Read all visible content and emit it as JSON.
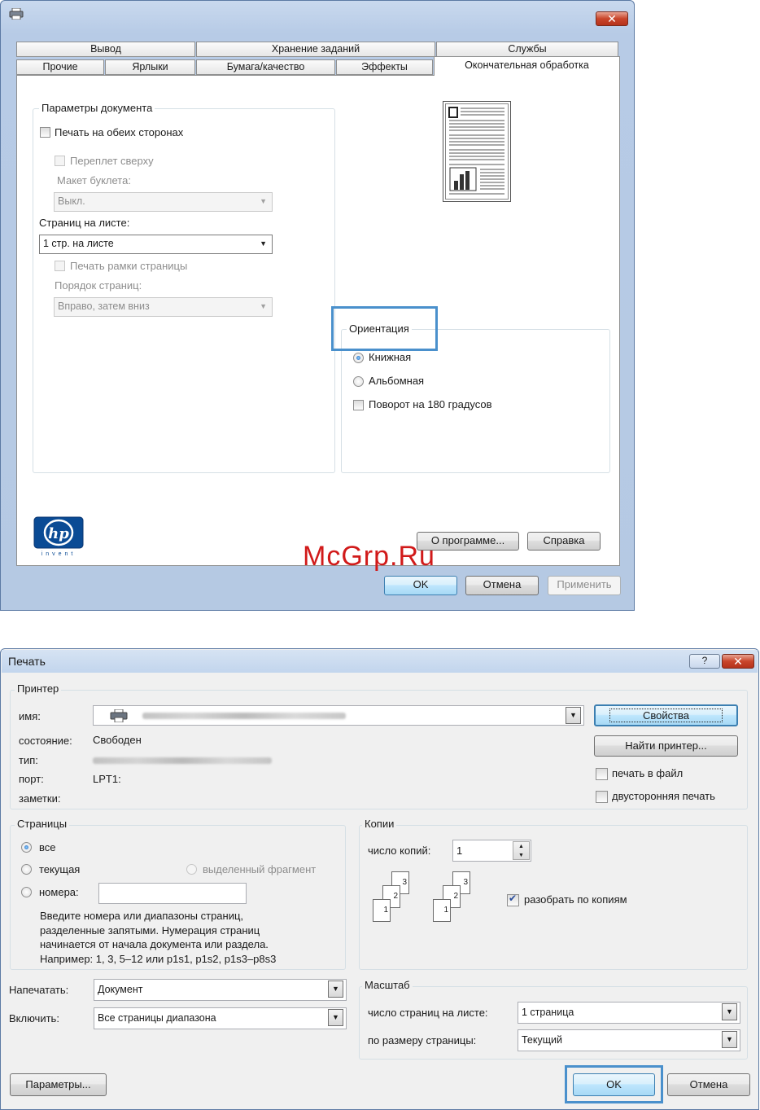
{
  "window1": {
    "tabs_row1": [
      "Вывод",
      "Хранение заданий",
      "Службы"
    ],
    "tabs_row2": [
      "Прочие",
      "Ярлыки",
      "Бумага/качество",
      "Эффекты",
      "Окончательная обработка"
    ],
    "close_glyph": "✕",
    "doc_options": {
      "title": "Параметры документа",
      "duplex": "Печать на обеих сторонах",
      "flip_up": "Переплет сверху",
      "booklet_label": "Макет буклета:",
      "booklet_value": "Выкл.",
      "pages_per_sheet_label": "Страниц на листе:",
      "pages_per_sheet_value": "1 стр. на листе",
      "page_borders": "Печать рамки страницы",
      "page_order_label": "Порядок страниц:",
      "page_order_value": "Вправо, затем вниз"
    },
    "orientation": {
      "title": "Ориентация",
      "portrait": "Книжная",
      "landscape": "Альбомная",
      "rotate": "Поворот на 180 градусов"
    },
    "logo_text": "invent",
    "buttons": {
      "about": "О программе...",
      "help": "Справка",
      "ok": "OK",
      "cancel": "Отмена",
      "apply": "Применить"
    }
  },
  "watermark": "McGrp.Ru",
  "window2": {
    "title": "Печать",
    "help_glyph": "?",
    "close_glyph": "✕",
    "printer": {
      "group": "Принтер",
      "name_label": "имя:",
      "status_label": "состояние:",
      "status_value": "Свободен",
      "type_label": "тип:",
      "port_label": "порт:",
      "port_value": "LPT1:",
      "notes_label": "заметки:",
      "properties": "Свойства",
      "find_printer": "Найти принтер...",
      "print_to_file": "печать в файл",
      "duplex": "двусторонняя печать"
    },
    "pages": {
      "group": "Страницы",
      "all": "все",
      "current": "текущая",
      "selection": "выделенный фрагмент",
      "numbers": "номера:",
      "hint": [
        "Введите номера или диапазоны страниц,",
        "разделенные запятыми. Нумерация страниц",
        "начинается от начала документа или раздела.",
        "Например: 1, 3, 5–12 или p1s1, p1s2, p1s3–p8s3"
      ]
    },
    "copies": {
      "group": "Копии",
      "count_label": "число копий:",
      "count_value": "1",
      "collate": "разобрать по копиям",
      "page_nums": [
        "1",
        "2",
        "3"
      ]
    },
    "print_what_label": "Напечатать:",
    "print_what_value": "Документ",
    "include_label": "Включить:",
    "include_value": "Все страницы диапазона",
    "zoom": {
      "group": "Масштаб",
      "pages_per_sheet_label": "число страниц на листе:",
      "pages_per_sheet_value": "1 страница",
      "scale_label": "по размеру страницы:",
      "scale_value": "Текущий"
    },
    "buttons": {
      "options": "Параметры...",
      "ok": "OK",
      "cancel": "Отмена"
    }
  }
}
